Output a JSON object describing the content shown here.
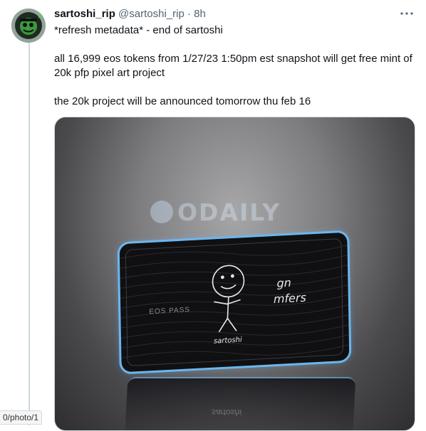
{
  "tweet": {
    "author_name": "sartoshi_rip",
    "author_handle": "@sartoshi_rip",
    "separator": "·",
    "time_ago": "8h",
    "more_icon": "more-icon",
    "paragraphs": [
      "*refresh metadata* - end of sartoshi",
      "all 16,999 eos tokens from 1/27/23 1:50pm est snapshot will get free mint of 20k pfp pixel art project",
      "the 20k project will be announced tomorrow thu feb 16"
    ]
  },
  "media": {
    "watermark_text": "ODAILY",
    "card_label": "EOS PASS",
    "card_text_line1": "gn",
    "card_text_line2": "mfers",
    "card_signature": "sartoshi",
    "reflection_text": "sartoshi"
  },
  "status_bar": {
    "url_fragment": "0/photo/1"
  },
  "colors": {
    "thread_line": "#cfd9de",
    "card_glow": "#6cb6ee",
    "secondary_text": "#536471"
  }
}
